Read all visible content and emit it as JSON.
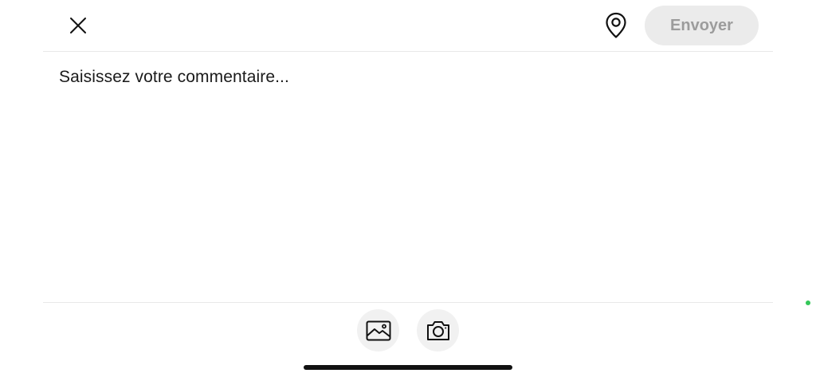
{
  "header": {
    "close_icon": "close-icon",
    "location_icon": "location-pin-icon",
    "send_label": "Envoyer"
  },
  "comment": {
    "placeholder": "Saisissez votre commentaire..."
  },
  "toolbar": {
    "buttons": [
      {
        "icon": "image-gallery-icon"
      },
      {
        "icon": "camera-icon"
      }
    ]
  },
  "colors": {
    "send_button_bg": "#ebebeb",
    "send_button_text": "#9c9c9c",
    "tool_button_bg": "#f1f1f1",
    "status_dot": "#34c759"
  }
}
